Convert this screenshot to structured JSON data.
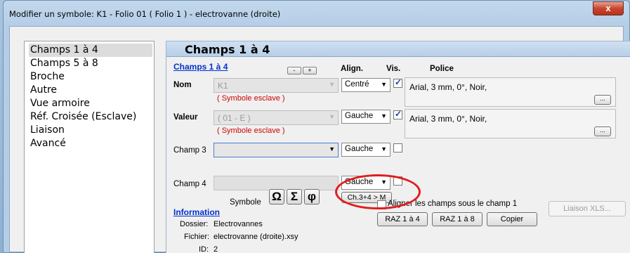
{
  "window": {
    "title": "Modifier un symbole: K1 - Folio 01 ( Folio 1 ) - electrovanne (droite)",
    "close_label": "x"
  },
  "nav": {
    "items": [
      "Champs 1 à 4",
      "Champs 5 à 8",
      "Broche",
      "Autre",
      "Vue armoire",
      "Réf. Croisée (Esclave)",
      "Liaison",
      "Avancé"
    ],
    "selected": "Champs 1 à 4"
  },
  "panel": {
    "title": "Champs 1 à 4",
    "fields_link": "Champs 1 à 4",
    "minus_label": "-",
    "plus_label": "+",
    "col_align": "Align.",
    "col_vis": "Vis.",
    "col_police": "Police",
    "nom": {
      "label": "Nom",
      "value": "K1",
      "note": "( Symbole esclave )",
      "align": "Centré",
      "visible": true,
      "police": "Arial, 3 mm, 0°, Noir,",
      "dots": "..."
    },
    "valeur": {
      "label": "Valeur",
      "value": "( 01 - E )",
      "note": "( Symbole esclave )",
      "align": "Gauche",
      "visible": true,
      "police": "Arial, 3 mm, 0°, Noir,",
      "dots": "..."
    },
    "champ3": {
      "label": "Champ 3",
      "value": "",
      "align": "Gauche",
      "visible": false
    },
    "champ4": {
      "label": "Champ 4",
      "value": "",
      "align": "Gauche",
      "visible": false
    },
    "ch_btn": "Ch.3+4 > M",
    "symbole_label": "Symbole",
    "symbols": [
      "Ω",
      "Σ",
      "φ"
    ],
    "aligner_label": "Aligner les champs sous le champ 1",
    "raz14": "RAZ 1 à 4",
    "raz18": "RAZ 1 à 8",
    "copier": "Copier",
    "liaison_xls": "Liaison XLS...",
    "information_link": "Information",
    "dossier_label": "Dossier:",
    "dossier_value": "Electrovannes",
    "fichier_label": "Fichier:",
    "fichier_value": "electrovanne (droite).xsy",
    "id_label": "ID:",
    "id_value": "2"
  },
  "colors": {
    "annotation": "#e11d1d",
    "link": "#0033cc",
    "slave_note": "#d00000"
  }
}
